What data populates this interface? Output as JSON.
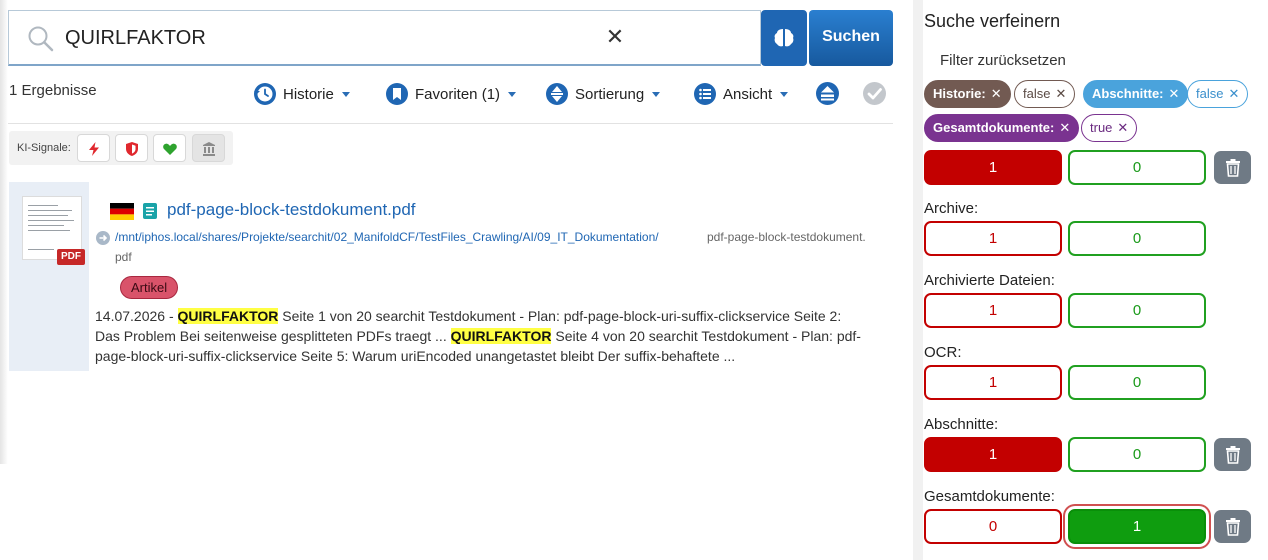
{
  "search": {
    "query": "QUIRLFAKTOR",
    "button_label": "Suchen",
    "clear_glyph": "✕"
  },
  "results": {
    "count_text": "1 Ergebnisse"
  },
  "toolbar": {
    "history_label": "Historie",
    "favorites_label": "Favoriten (1)",
    "sort_label": "Sortierung",
    "view_label": "Ansicht"
  },
  "signals": {
    "label": "KI-Signale:",
    "icons": [
      "lightning-icon",
      "shield-icon",
      "heart-icon",
      "bank-icon"
    ],
    "colors": {
      "lightning": "#e0282e",
      "shield": "#e0282e",
      "heart": "#2ea32e",
      "bank": "#8a8a8a"
    }
  },
  "result": {
    "title": "pdf-page-block-testdokument.pdf",
    "path": "/mnt/iphos.local/shares/Projekte/searchit/02_ManifoldCF/TestFiles_Crawling/AI/09_IT_Dokumentation/",
    "filename_part1": "pdf-page-block-testdokument.",
    "filename_part2": "pdf",
    "badge": "Artikel",
    "pdf_label": "PDF",
    "snippet": {
      "date": "14.07.2026 - ",
      "hit1": "QUIRLFAKTOR",
      "text1": " Seite 1 von 20 searchit Testdokument - Plan: pdf-page-block-uri-suffix-clickservice Seite 2: Das Problem Bei seitenweise gesplitteten PDFs traegt ... ",
      "hit2": "QUIRLFAKTOR",
      "text2": " Seite 4 von 20 searchit Testdokument - Plan: pdf-page-block-uri-suffix-clickservice Seite 5: Warum uriEncoded unangetastet bleibt Der suffix-behaftete ..."
    }
  },
  "refine": {
    "title": "Suche verfeinern",
    "reset_label": "Filter zurücksetzen",
    "chips": {
      "historie": "Historie:",
      "historie_value": "false",
      "abschnitte": "Abschnitte:",
      "abschnitte_value": "false",
      "gesamt": "Gesamtdokumente:",
      "gesamt_value": "true",
      "remove_glyph": "✕"
    },
    "facets": {
      "first": {
        "red": "1",
        "green": "0"
      },
      "archive": {
        "label": "Archive:",
        "red": "1",
        "green": "0"
      },
      "archived_files": {
        "label": "Archivierte Dateien:",
        "red": "1",
        "green": "0"
      },
      "ocr": {
        "label": "OCR:",
        "red": "1",
        "green": "0"
      },
      "sections": {
        "label": "Abschnitte:",
        "red": "1",
        "green": "0"
      },
      "total_docs": {
        "label": "Gesamtdokumente:",
        "red": "0",
        "green": "1"
      }
    }
  },
  "colors": {
    "brand_blue": "#1f66b3",
    "facet_red": "#c30000",
    "facet_green": "#0f9d0f",
    "highlight": "#ffff44"
  }
}
